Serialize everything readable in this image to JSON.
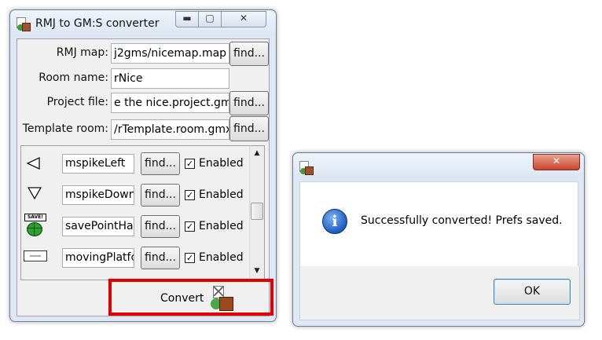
{
  "main_window": {
    "title": "RMJ to GM:S converter",
    "min_glyph": "▬",
    "max_glyph": "▢",
    "close_glyph": "✕",
    "fields": [
      {
        "label": "RMJ map:",
        "value": "j2gms/nicemap.map",
        "button": "find..."
      },
      {
        "label": "Room name:",
        "value": "rNice",
        "button": ""
      },
      {
        "label": "Project file:",
        "value": "e the nice.project.gmx",
        "button": "find..."
      },
      {
        "label": "Template room:",
        "value": "/rTemplate.room.gmx",
        "button": "find..."
      }
    ],
    "objects": [
      {
        "icon": "triangle-left-icon",
        "name": "mspikeLeft",
        "button": "find...",
        "enabled_label": "Enabled",
        "checked": true
      },
      {
        "icon": "triangle-down-icon",
        "name": "mspikeDown",
        "button": "find...",
        "enabled_label": "Enabled",
        "checked": true
      },
      {
        "icon": "save-point-icon",
        "name": "savePointHar",
        "button": "find...",
        "enabled_label": "Enabled",
        "checked": true,
        "icon_text": "SAVE!"
      },
      {
        "icon": "moving-platform-icon",
        "name": "movingPlatfc",
        "button": "find...",
        "enabled_label": "Enabled",
        "checked": true
      }
    ],
    "convert_label": "Convert",
    "highlight_color": "#e00000"
  },
  "dialog": {
    "title": "",
    "close_glyph": "✕",
    "info_glyph": "i",
    "message": "Successfully converted! Prefs saved.",
    "ok_label": "OK"
  }
}
